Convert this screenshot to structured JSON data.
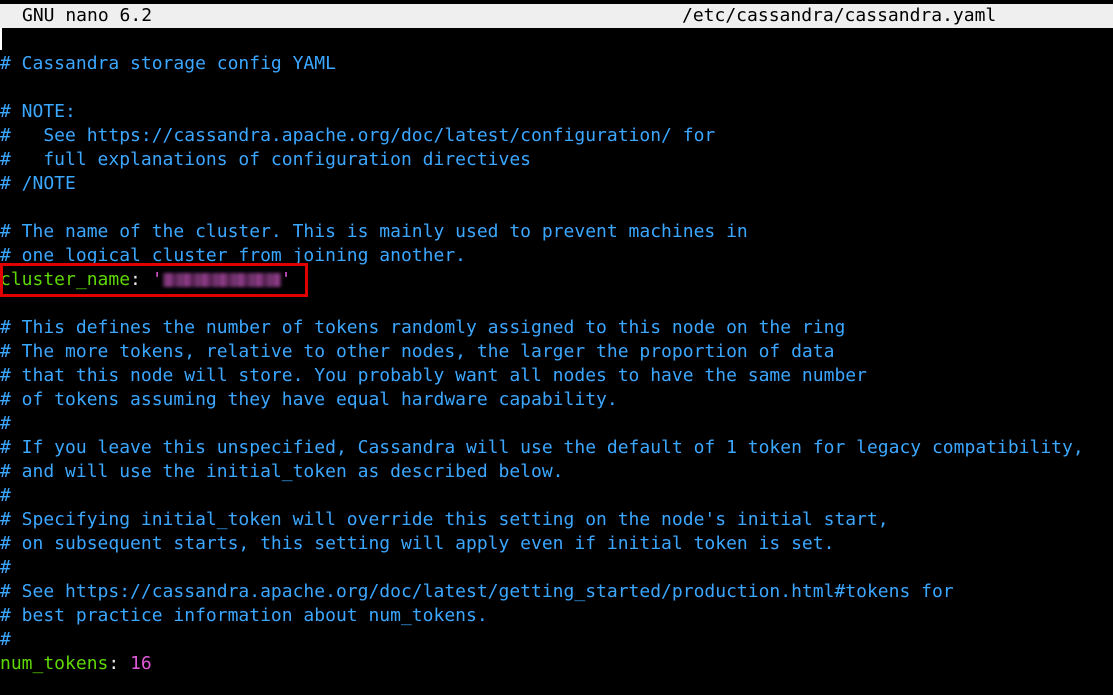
{
  "titlebar": {
    "app_name": "GNU nano 6.2",
    "file_path": "/etc/cassandra/cassandra.yaml"
  },
  "editor": {
    "lines": [
      {
        "type": "comment",
        "text": "# Cassandra storage config YAML"
      },
      {
        "type": "blank",
        "text": ""
      },
      {
        "type": "comment",
        "text": "# NOTE:"
      },
      {
        "type": "comment",
        "text": "#   See https://cassandra.apache.org/doc/latest/configuration/ for"
      },
      {
        "type": "comment",
        "text": "#   full explanations of configuration directives"
      },
      {
        "type": "comment",
        "text": "# /NOTE"
      },
      {
        "type": "blank",
        "text": ""
      },
      {
        "type": "comment",
        "text": "# The name of the cluster. This is mainly used to prevent machines in"
      },
      {
        "type": "comment",
        "text": "# one logical cluster from joining another."
      },
      {
        "type": "setting",
        "key": "cluster_name",
        "sep": ": ",
        "quote_open": "'",
        "value": "",
        "quote_close": "'",
        "redacted": true
      },
      {
        "type": "blank",
        "text": ""
      },
      {
        "type": "comment",
        "text": "# This defines the number of tokens randomly assigned to this node on the ring"
      },
      {
        "type": "comment",
        "text": "# The more tokens, relative to other nodes, the larger the proportion of data"
      },
      {
        "type": "comment",
        "text": "# that this node will store. You probably want all nodes to have the same number"
      },
      {
        "type": "comment",
        "text": "# of tokens assuming they have equal hardware capability."
      },
      {
        "type": "comment",
        "text": "#"
      },
      {
        "type": "comment",
        "text": "# If you leave this unspecified, Cassandra will use the default of 1 token for legacy compatibility,"
      },
      {
        "type": "comment",
        "text": "# and will use the initial_token as described below."
      },
      {
        "type": "comment",
        "text": "#"
      },
      {
        "type": "comment",
        "text": "# Specifying initial_token will override this setting on the node's initial start,"
      },
      {
        "type": "comment",
        "text": "# on subsequent starts, this setting will apply even if initial token is set."
      },
      {
        "type": "comment",
        "text": "#"
      },
      {
        "type": "comment",
        "text": "# See https://cassandra.apache.org/doc/latest/getting_started/production.html#tokens for"
      },
      {
        "type": "comment",
        "text": "# best practice information about num_tokens."
      },
      {
        "type": "comment",
        "text": "#"
      },
      {
        "type": "number_setting",
        "key": "num_tokens",
        "sep": ": ",
        "value": "16"
      }
    ]
  },
  "colors": {
    "background": "#000000",
    "titlebar_bg": "#efefef",
    "comment": "#3ba7ff",
    "key": "#5fd700",
    "value": "#e05ad6",
    "highlight_border": "#e00000"
  }
}
